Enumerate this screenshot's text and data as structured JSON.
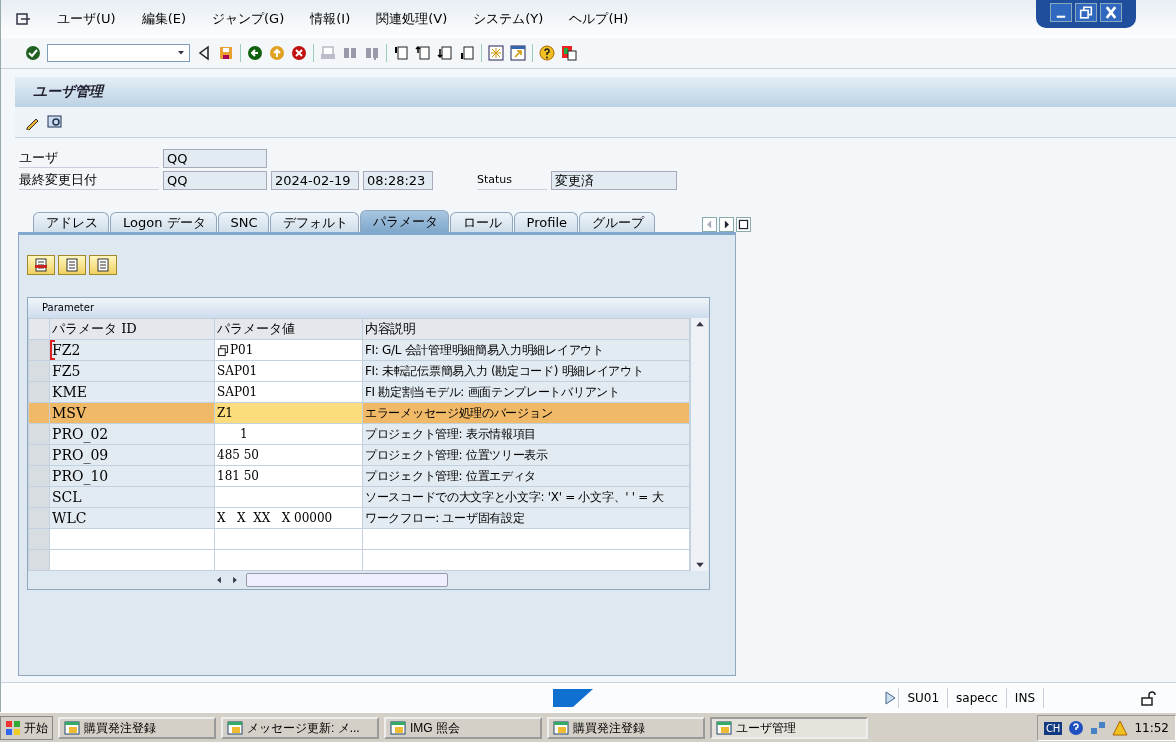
{
  "menu": [
    {
      "label": "ユーザ(U)"
    },
    {
      "label": "編集(E)"
    },
    {
      "label": "ジャンプ(G)"
    },
    {
      "label": "情報(I)"
    },
    {
      "label": "関連処理(V)"
    },
    {
      "label": "システム(Y)"
    },
    {
      "label": "ヘルプ(H)"
    }
  ],
  "screen": {
    "title": "ユーザ管理"
  },
  "form": {
    "user_label": "ユーザ",
    "user": "QQ",
    "changed_label": "最終変更日付",
    "changed_by": "QQ",
    "changed_date": "2024-02-19",
    "changed_time": "08:28:23",
    "status_label": "Status",
    "status": "変更済"
  },
  "tabs": [
    {
      "label": "アドレス",
      "selected": false
    },
    {
      "label": "Logon データ",
      "selected": false
    },
    {
      "label": "SNC",
      "selected": false
    },
    {
      "label": "デフォルト",
      "selected": false
    },
    {
      "label": "パラメータ",
      "selected": true
    },
    {
      "label": "ロール",
      "selected": false
    },
    {
      "label": "Profile",
      "selected": false
    },
    {
      "label": "グループ",
      "selected": false
    }
  ],
  "table": {
    "title": "Parameter",
    "columns": [
      "パラメータ ID",
      "パラメータ値",
      "内容説明"
    ],
    "rows": [
      {
        "cells": [
          "FZ2",
          "P01",
          "FI: G/L 会計管理明細簡易入力明細レイアウト"
        ],
        "selected": false,
        "focused": true
      },
      {
        "cells": [
          "FZ5",
          "SAP01",
          "FI: 未転記伝票簡易入力 (勘定コード) 明細レイアウト"
        ],
        "selected": false,
        "focused": false
      },
      {
        "cells": [
          "KME",
          "SAP01",
          "FI 勘定割当モデル: 画面テンプレートバリアント"
        ],
        "selected": false,
        "focused": false
      },
      {
        "cells": [
          "MSV",
          "Z1",
          "エラーメッセージ処理のバージョン"
        ],
        "selected": true,
        "focused": false
      },
      {
        "cells": [
          "PRO_02",
          "      1",
          "プロジェクト管理: 表示情報項目"
        ],
        "selected": false,
        "focused": false
      },
      {
        "cells": [
          "PRO_09",
          "485 50",
          "プロジェクト管理: 位置ツリー表示"
        ],
        "selected": false,
        "focused": false
      },
      {
        "cells": [
          "PRO_10",
          "181 50",
          "プロジェクト管理: 位置エディタ"
        ],
        "selected": false,
        "focused": false
      },
      {
        "cells": [
          "SCL",
          null,
          "ソースコードでの大文字と小文字: 'X' = 小文字、' ' = 大"
        ],
        "selected": false,
        "focused": false
      },
      {
        "cells": [
          "WLC",
          "X   X  XX   X 00000",
          "ワークフロー: ユーザ固有設定"
        ],
        "selected": false,
        "focused": false
      }
    ]
  },
  "status_bar": {
    "transaction": "SU01",
    "system": "sapecc",
    "mode": "INS"
  },
  "taskbar": {
    "start": "开始",
    "tasks": [
      {
        "label": "購買発注登録",
        "selected": false
      },
      {
        "label": "メッセージ更新: メ...",
        "selected": false
      },
      {
        "label": "IMG 照会",
        "selected": false
      },
      {
        "label": "購買発注登録",
        "selected": false
      },
      {
        "label": "ユーザ管理",
        "selected": true
      }
    ],
    "language": "CH",
    "clock": "11:52"
  }
}
